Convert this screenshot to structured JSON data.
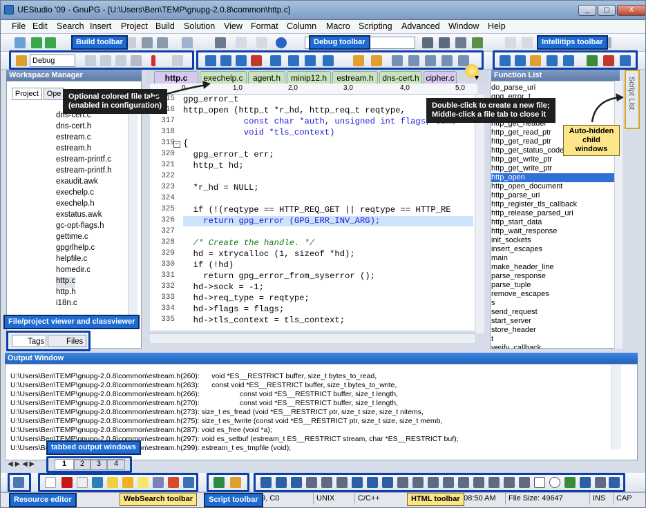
{
  "window": {
    "title": "UEStudio '09 - GnuPG - [U:\\Users\\Ben\\TEMP\\gnupg-2.0.8\\common\\http.c]",
    "min": "_",
    "max": "▢",
    "close": "X"
  },
  "menu": [
    "File",
    "Edit",
    "Search",
    "Insert",
    "Project",
    "Build",
    "Solution",
    "View",
    "Format",
    "Column",
    "Macro",
    "Scripting",
    "Advanced",
    "Window",
    "Help"
  ],
  "toolbar": {
    "config_select": "Debug",
    "search_field": "d"
  },
  "callouts": {
    "build": "Build toolbar",
    "debug": "Debug toolbar",
    "intellitips": "Intellitips toolbar",
    "filetabs_l1": "Optional colored file tabs",
    "filetabs_l2": "(enabled in configuration)",
    "dblclick_l1": "Double-click to create a new file;",
    "dblclick_l2": "Middle-click a file tab to close it",
    "autohidden_l1": "Auto-hidden",
    "autohidden_l2": "child windows",
    "fileviewer": "File/project viewer and classviewer",
    "tabbed": "tabbed output windows",
    "resource": "Resource editor",
    "websearch": "WebSearch toolbar",
    "script": "Script toolbar",
    "html": "HTML toolbar"
  },
  "workspace": {
    "title": "Workspace Manager",
    "tabs": [
      "Project",
      "Ope"
    ],
    "files": [
      "dns-cert.c",
      "dns-cert.h",
      "estream.c",
      "estream.h",
      "estream-printf.c",
      "estream-printf.h",
      "exaudit.awk",
      "exechelp.c",
      "exechelp.h",
      "exstatus.awk",
      "gc-opt-flags.h",
      "gettime.c",
      "gpgrlhelp.c",
      "helpfile.c",
      "homedir.c",
      "http.c",
      "http.h",
      "i18n.c"
    ],
    "bottom_tabs": [
      "Tags",
      "Files"
    ]
  },
  "file_tabs": [
    "http.c",
    "exechelp.c",
    "agent.h",
    "minip12.h",
    "estream.h",
    "dns-cert.h",
    "cipher.c"
  ],
  "ruler": [
    "0",
    "1,0",
    "2,0",
    "3,0",
    "4,0",
    "5,0"
  ],
  "code": {
    "line_numbers": [
      "315",
      "316",
      "317",
      "318",
      "319",
      "320",
      "321",
      "322",
      "323",
      "324",
      "325",
      "326",
      "327",
      "328",
      "329",
      "330",
      "331",
      "332",
      "333",
      "334",
      "335"
    ],
    "lines": [
      "gpg_error_t",
      "http_open (http_t *r_hd, http_req_t reqtype,",
      "            const char *auth, unsigned int flags, cons",
      "            void *tls_context)",
      "{",
      "  gpg_error_t err;",
      "  http_t hd;",
      "",
      "  *r_hd = NULL;",
      "",
      "  if (!(reqtype == HTTP_REQ_GET || reqtype == HTTP_RE",
      "    return gpg_error (GPG_ERR_INV_ARG);",
      "",
      "  /* Create the handle. */",
      "  hd = xtrycalloc (1, sizeof *hd);",
      "  if (!hd)",
      "    return gpg_error_from_syserror ();",
      "  hd->sock = -1;",
      "  hd->req_type = reqtype;",
      "  hd->flags = flags;",
      "  hd->tls_context = tls_context;"
    ]
  },
  "function_list": {
    "title": "Function List",
    "items": [
      "do_parse_uri",
      "gpg_error_t",
      "http_close",
      "http_get_header",
      "http_get_read_ptr",
      "http_get_read_ptr",
      "http_get_status_code",
      "http_get_write_ptr",
      "http_get_write_ptr",
      "http_open",
      "http_open_document",
      "http_parse_uri",
      "http_register_tls_callback",
      "http_release_parsed_uri",
      "http_start_data",
      "http_wait_response",
      "init_sockets",
      "insert_escapes",
      "main",
      "make_header_line",
      "parse_response",
      "parse_tuple",
      "remove_escapes",
      "s",
      "send_request",
      "start_server",
      "store_header",
      "t",
      "verify_callback"
    ],
    "selected": "http_open"
  },
  "script_list": {
    "title": "Script List"
  },
  "output": {
    "title": "Output Window",
    "lines": [
      "U:\\Users\\Ben\\TEMP\\gnupg-2.0.8\\common\\estream.h(260):      void *ES__RESTRICT buffer, size_t bytes_to_read,",
      "U:\\Users\\Ben\\TEMP\\gnupg-2.0.8\\common\\estream.h(263):      const void *ES__RESTRICT buffer, size_t bytes_to_write,",
      "U:\\Users\\Ben\\TEMP\\gnupg-2.0.8\\common\\estream.h(266):                    const void *ES__RESTRICT buffer, size_t length,",
      "U:\\Users\\Ben\\TEMP\\gnupg-2.0.8\\common\\estream.h(270):                    const void *ES__RESTRICT buffer, size_t length,",
      "U:\\Users\\Ben\\TEMP\\gnupg-2.0.8\\common\\estream.h(273): size_t es_fread (void *ES__RESTRICT ptr, size_t size, size_t nitems,",
      "U:\\Users\\Ben\\TEMP\\gnupg-2.0.8\\common\\estream.h(275): size_t es_fwrite (const void *ES__RESTRICT ptr, size_t size, size_t memb,",
      "U:\\Users\\Ben\\TEMP\\gnupg-2.0.8\\common\\estream.h(287): void es_free (void *a);",
      "U:\\Users\\Ben\\TEMP\\gnupg-2.0.8\\common\\estream.h(297): void es_setbuf (estream_t ES__RESTRICT stream, char *ES__RESTRICT buf);",
      "U:\\Users\\Ben\\TEMP\\gnupg-2.0.8\\common\\estream.h(299): estream_t es_tmpfile (void);"
    ],
    "tabs": [
      "1",
      "2",
      "3",
      "4"
    ]
  },
  "status": {
    "line_prefix": "1",
    "pos": "39, C0",
    "format": "UNIX",
    "lang": "C/C++",
    "time": "8:08:50 AM",
    "filesize": "File Size: 49647",
    "ins": "INS",
    "cap": "CAP"
  },
  "colors": {
    "selected_fn": "#2e6fd8",
    "highlight_line": "#cce4fb",
    "callout_blue": "#1d6bd3",
    "callout_border": "#0c2b66",
    "gold": "#d8a51f"
  }
}
